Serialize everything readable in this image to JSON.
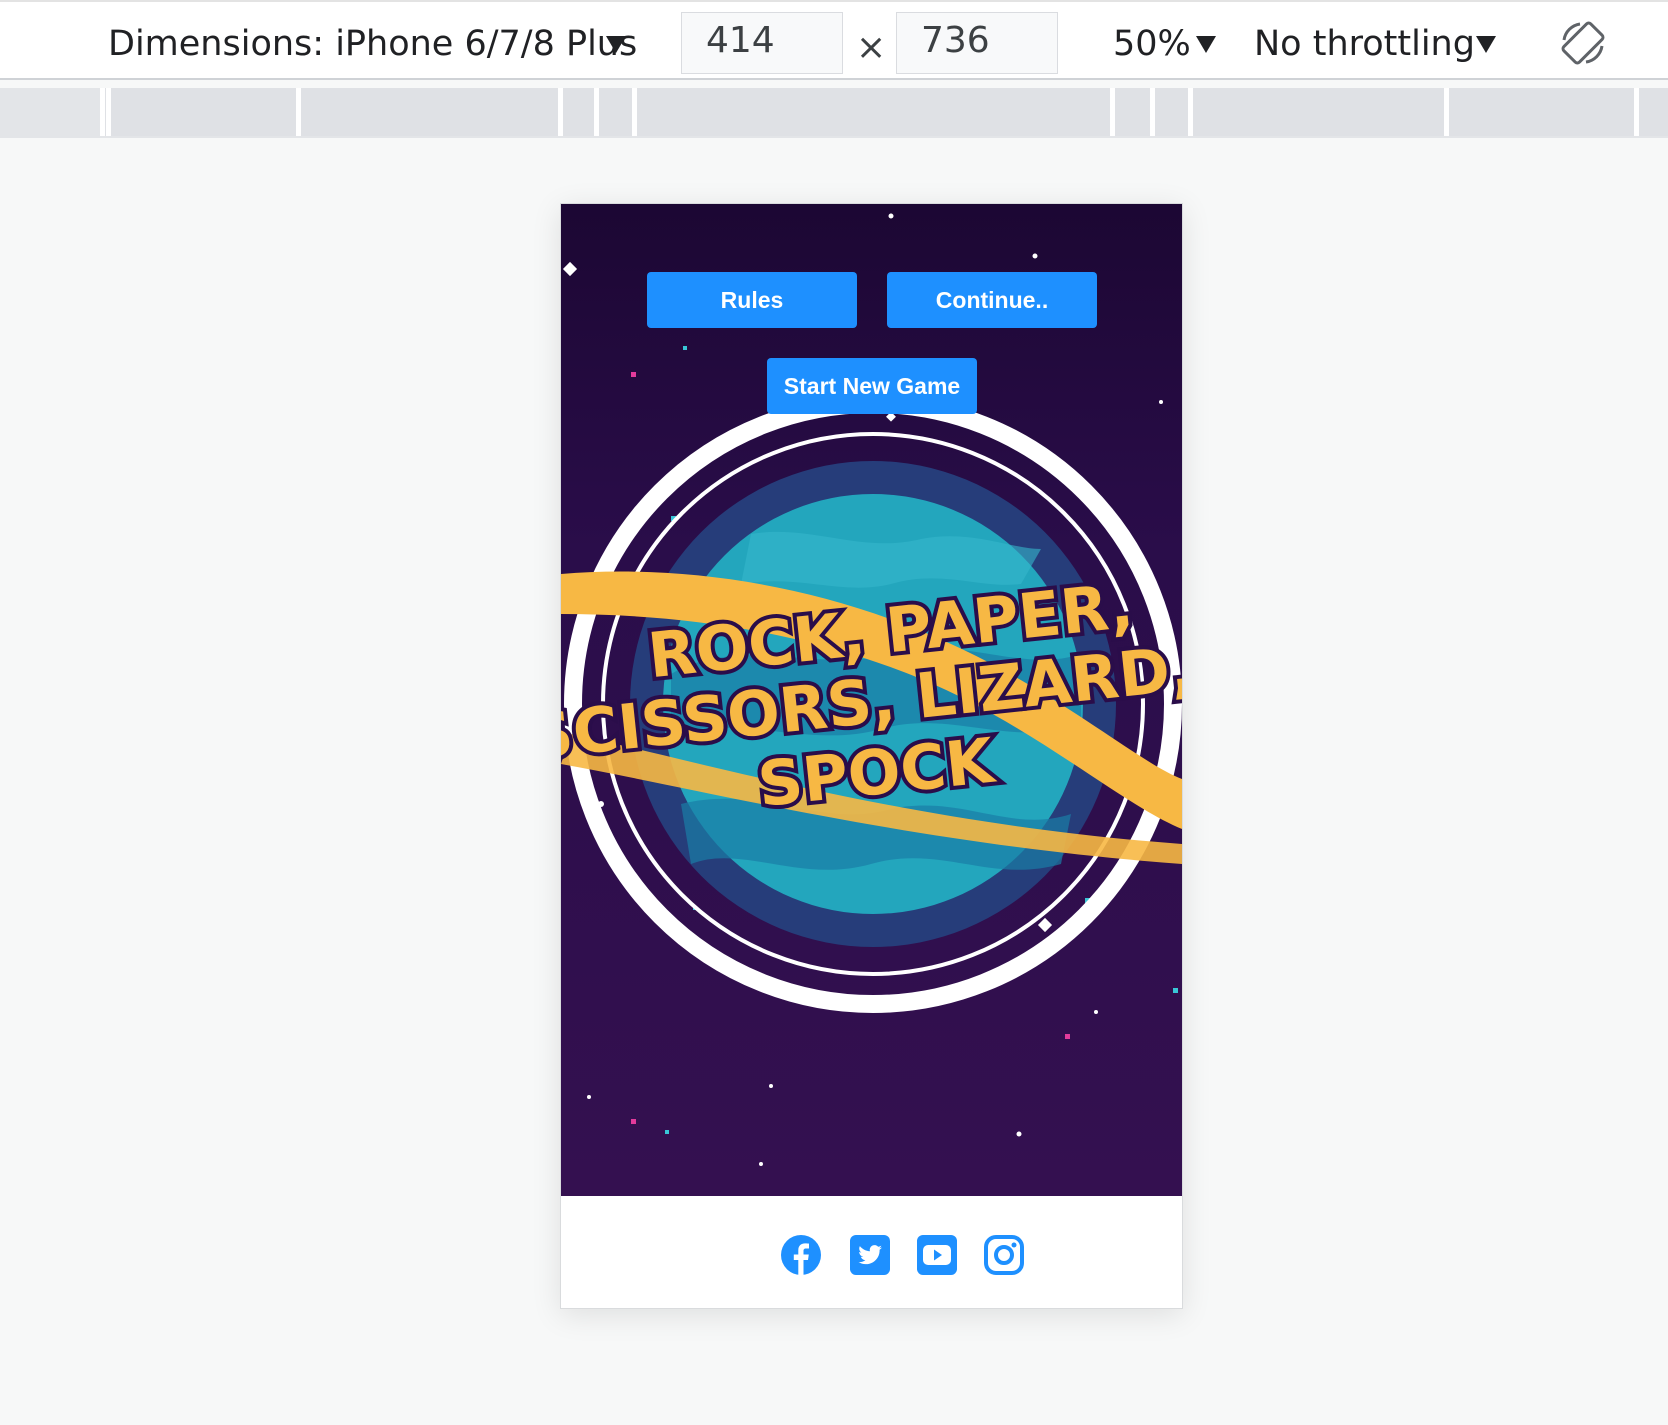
{
  "devtools": {
    "dimensions_label": "Dimensions: iPhone 6/7/8 Plus",
    "width_value": "414",
    "height_value": "736",
    "times_symbol": "×",
    "zoom_label": "50%",
    "throttling_label": "No throttling",
    "icons": {
      "dimensions_dropdown": "caret-down-icon",
      "zoom_dropdown": "caret-down-icon",
      "throttling_dropdown": "caret-down-icon",
      "rotate": "rotate-icon"
    }
  },
  "game": {
    "rules_label": "Rules",
    "continue_label": "Continue..",
    "new_game_label": "Start New Game",
    "logo_title_lines": [
      "ROCK, PAPER,",
      "SCISSORS, LIZARD,",
      "SPOCK"
    ],
    "colors": {
      "button": "#1e90ff",
      "space": "#2a0d4a",
      "planet": "#23a6bd",
      "title": "#f7b844",
      "social": "#1e90ff"
    }
  },
  "footer": {
    "social_icons": [
      "facebook-icon",
      "twitter-icon",
      "youtube-icon",
      "instagram-icon"
    ]
  }
}
